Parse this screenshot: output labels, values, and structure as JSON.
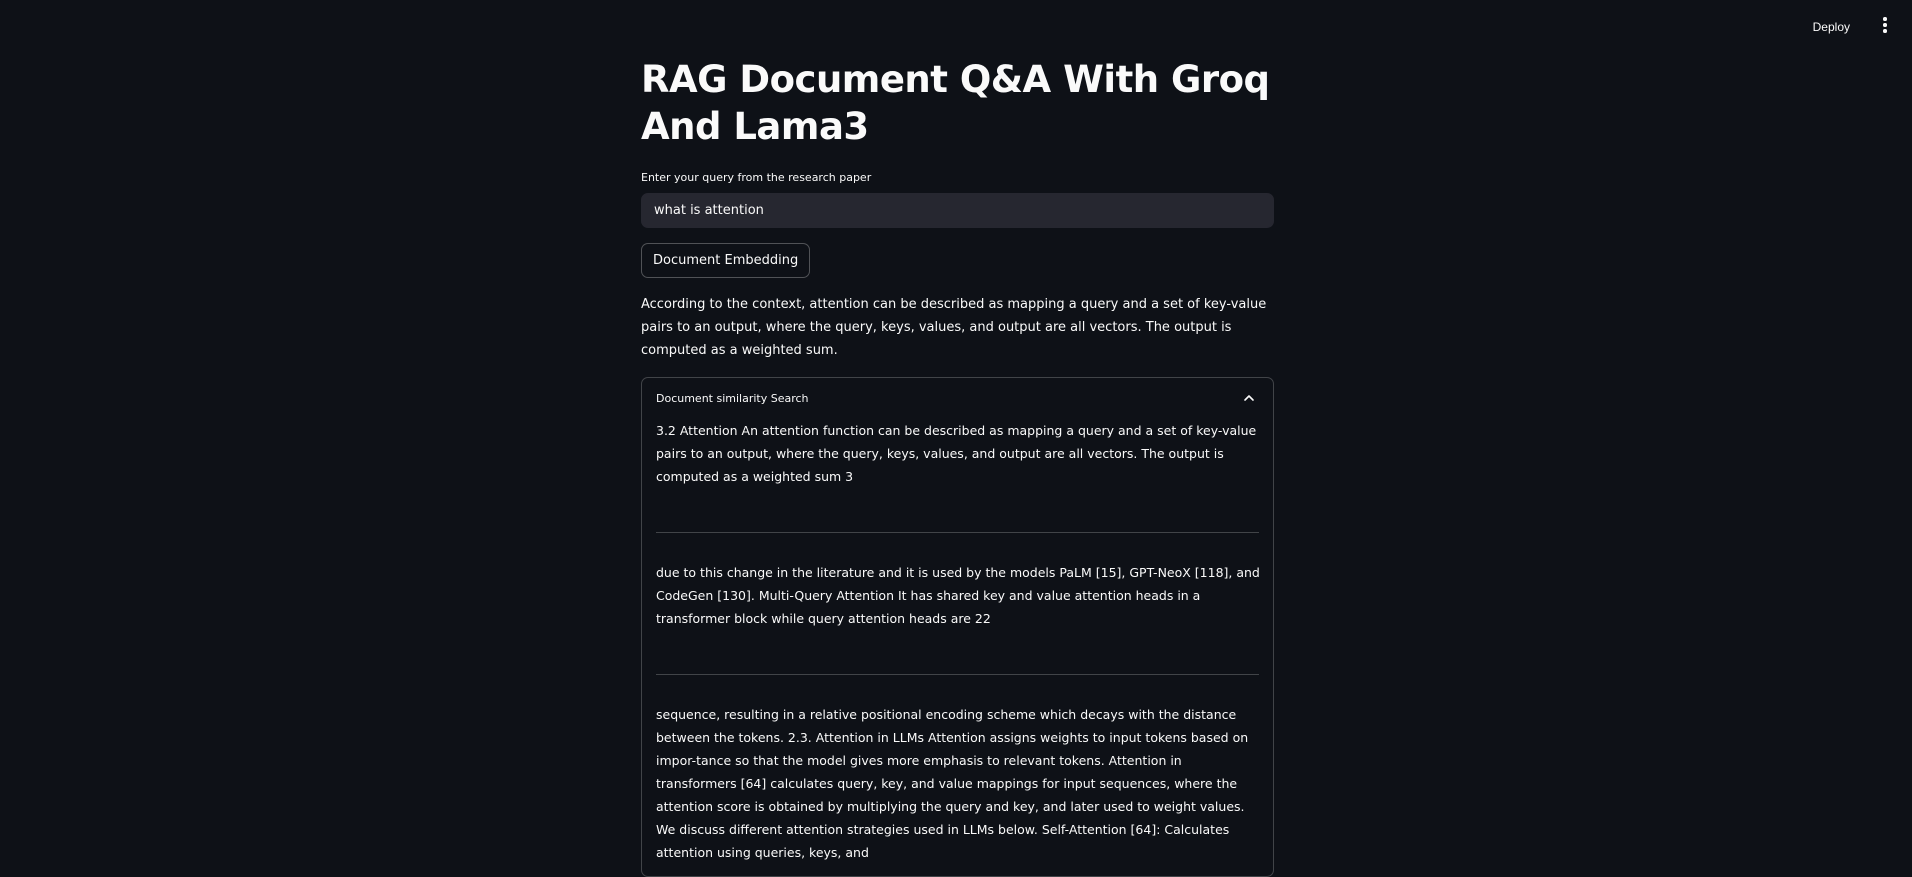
{
  "header": {
    "deploy_label": "Deploy",
    "menu_icon": "kebab-vertical-icon"
  },
  "main": {
    "title": "RAG Document Q&A With Groq And Lama3",
    "query_label": "Enter your query from the research paper",
    "query_value": "what is attention",
    "embed_button_label": "Document Embedding",
    "answer": "According to the context, attention can be described as mapping a query and a set of key-value pairs to an output, where the query, keys, values, and output are all vectors. The output is computed as a weighted sum."
  },
  "expander": {
    "title": "Document similarity Search",
    "toggle_icon": "chevron-up-icon",
    "chunks": [
      "3.2 Attention An attention function can be described as mapping a query and a set of key-value pairs to an output, where the query, keys, values, and output are all vectors. The output is computed as a weighted sum 3",
      "due to this change in the literature and it is used by the models PaLM [15], GPT-NeoX [118], and CodeGen [130]. Multi-Query Attention It has shared key and value attention heads in a transformer block while query attention heads are 22",
      "sequence, resulting in a relative positional encoding scheme which decays with the distance between the tokens. 2.3. Attention in LLMs Attention assigns weights to input tokens based on impor-tance so that the model gives more emphasis to relevant tokens. Attention in transformers [64] calculates query, key, and value mappings for input sequences, where the attention score is obtained by multiplying the query and key, and later used to weight values. We discuss different attention strategies used in LLMs below. Self-Attention [64]: Calculates attention using queries, keys, and"
    ]
  },
  "colors": {
    "background": "#0e1117",
    "text": "#fafafa",
    "input_bg": "#262730"
  }
}
